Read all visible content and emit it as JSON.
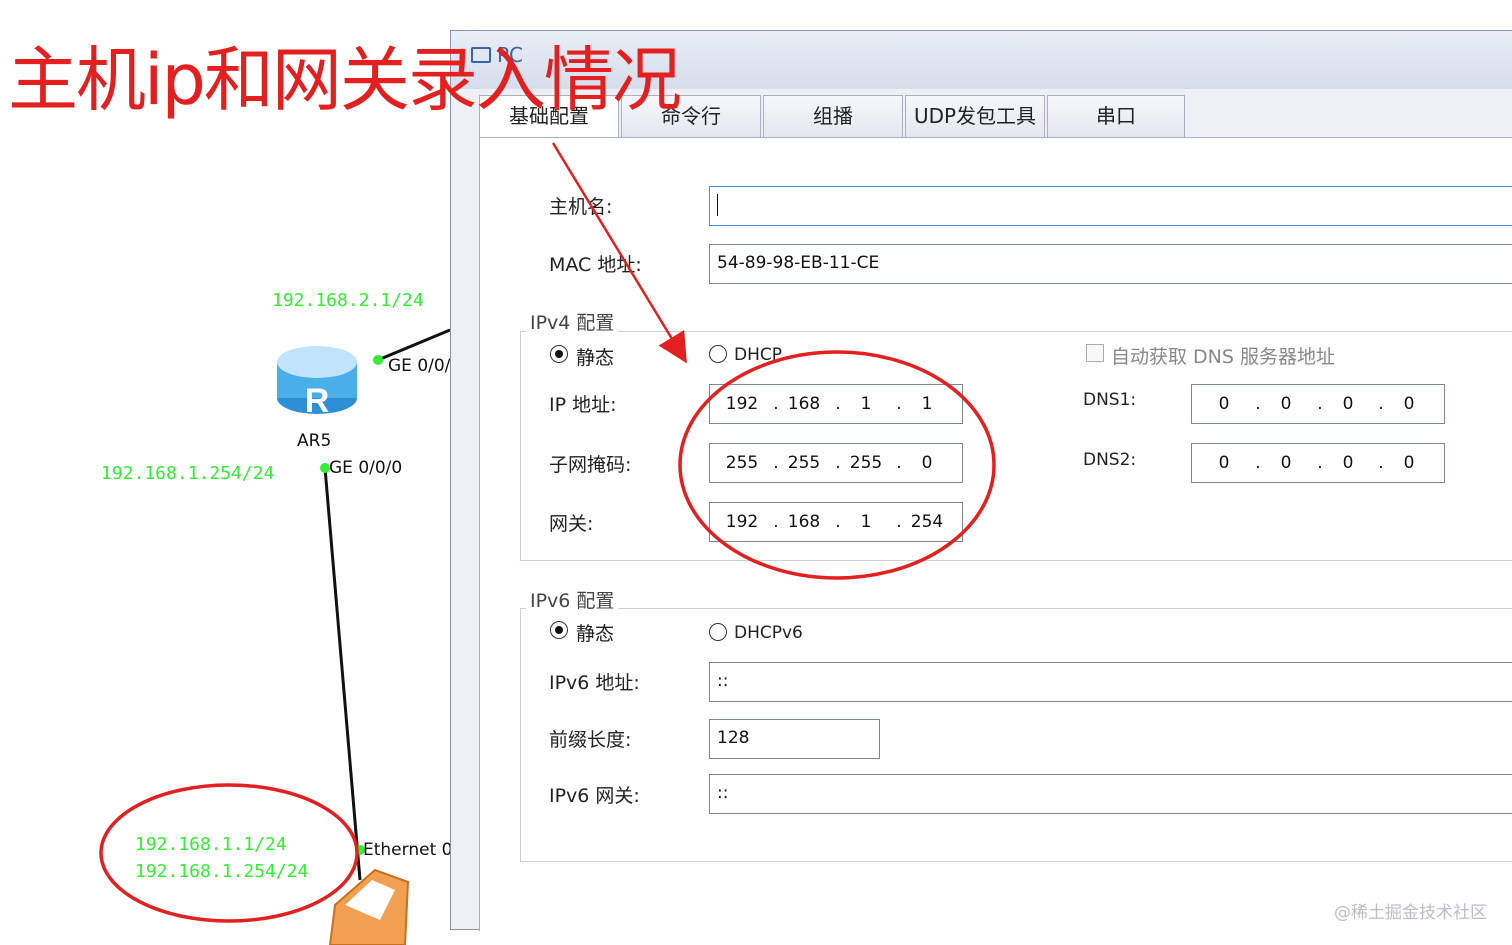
{
  "annotation": {
    "title": "主机ip和网关录入情况",
    "color": "#e3201f"
  },
  "topology": {
    "router": {
      "name": "AR5",
      "icon": "router-icon",
      "letter": "R"
    },
    "iface_top": "GE 0/0/",
    "iface_bottom": "GE 0/0/0",
    "ip_top": "192.168.2.1/24",
    "ip_router_lan": "192.168.1.254/24",
    "pc_iface": "Ethernet 0",
    "pc_ip": "192.168.1.1/24",
    "pc_gw": "192.168.1.254/24",
    "link_color": "#33ee33"
  },
  "dialog": {
    "title": "PC",
    "tabs": [
      "基础配置",
      "命令行",
      "组播",
      "UDP发包工具",
      "串口"
    ],
    "hostname_label": "主机名:",
    "hostname_value": "",
    "mac_label": "MAC 地址:",
    "mac_value": "54-89-98-EB-11-CE",
    "ipv4": {
      "group_title": "IPv4 配置",
      "static_label": "静态",
      "dhcp_label": "DHCP",
      "auto_dns_label": "自动获取 DNS 服务器地址",
      "ip_label": "IP 地址:",
      "ip": [
        "192",
        "168",
        "1",
        "1"
      ],
      "mask_label": "子网掩码:",
      "mask": [
        "255",
        "255",
        "255",
        "0"
      ],
      "gw_label": "网关:",
      "gw": [
        "192",
        "168",
        "1",
        "254"
      ],
      "dns1_label": "DNS1:",
      "dns1": [
        "0",
        "0",
        "0",
        "0"
      ],
      "dns2_label": "DNS2:",
      "dns2": [
        "0",
        "0",
        "0",
        "0"
      ]
    },
    "ipv6": {
      "group_title": "IPv6 配置",
      "static_label": "静态",
      "dhcp_label": "DHCPv6",
      "addr_label": "IPv6 地址:",
      "addr_value": "::",
      "prefix_label": "前缀长度:",
      "prefix_value": "128",
      "gw_label": "IPv6 网关:",
      "gw_value": "::"
    }
  },
  "watermark": "@稀土掘金技术社区"
}
